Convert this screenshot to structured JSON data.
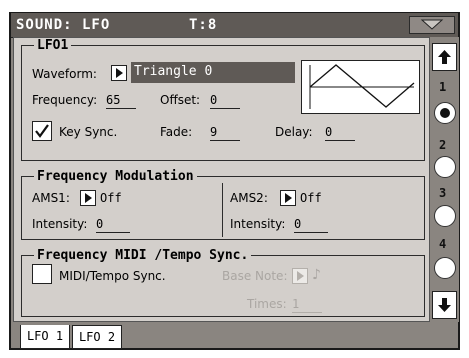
{
  "title": {
    "screen": "SOUND: LFO",
    "tempo": "T:8"
  },
  "lfo_group": {
    "label": "LFO1",
    "waveform_label": "Waveform:",
    "waveform_value": "Triangle 0",
    "frequency_label": "Frequency:",
    "frequency_value": "65",
    "offset_label": "Offset:",
    "offset_value": "0",
    "key_sync_label": "Key Sync.",
    "key_sync_checked": true,
    "fade_label": "Fade:",
    "fade_value": "9",
    "delay_label": "Delay:",
    "delay_value": "0"
  },
  "freq_mod_group": {
    "label": "Frequency Modulation",
    "ams1_label": "AMS1:",
    "ams1_value": "Off",
    "intensity1_label": "Intensity:",
    "intensity1_value": "0",
    "ams2_label": "AMS2:",
    "ams2_value": "Off",
    "intensity2_label": "Intensity:",
    "intensity2_value": "0"
  },
  "midi_group": {
    "label": "Frequency MIDI /Tempo Sync.",
    "midi_sync_label": "MIDI/Tempo Sync.",
    "midi_sync_checked": false,
    "base_note_label": "Base Note:",
    "base_note_value": "♪",
    "times_label": "Times:",
    "times_value": "1"
  },
  "sidebar": {
    "up_icon": "arrow-up-icon",
    "down_icon": "arrow-down-icon",
    "pages": [
      "1",
      "2",
      "3",
      "4"
    ],
    "selected_page": "1"
  },
  "tabs": [
    "LFO 1",
    "LFO 2"
  ],
  "active_tab": "LFO 1",
  "colors": {
    "frame": "#8a8580",
    "title_bar": "#5f5a56",
    "panel": "#d3cfcb",
    "value_box": "#5f5a56"
  }
}
